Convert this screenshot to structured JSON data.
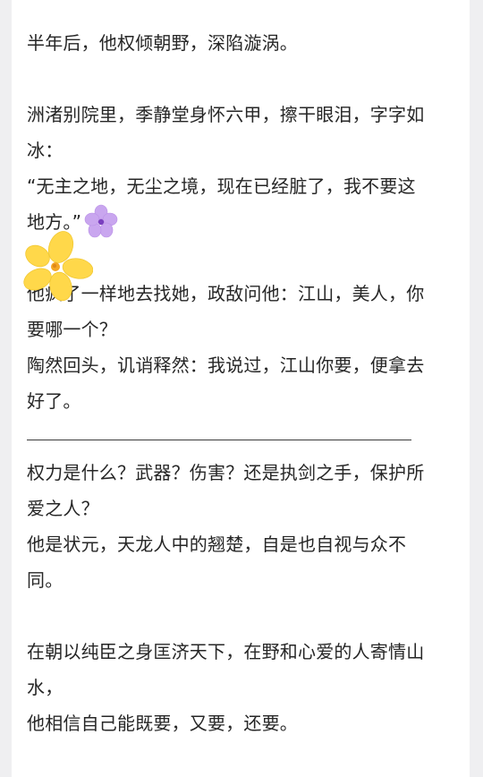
{
  "article": {
    "paragraphs": [
      "半年后，他权倾朝野，深陷漩涡。",
      "洲渚别院里，季静堂身怀六甲，擦干眼泪，字字如",
      "冰：",
      "“无主之地，无尘之境，现在已经脏了，我不要这",
      "地方。”",
      "他疯了一样地去找她，政敌问他：江山，美人，你",
      "要哪一个？",
      "陶然回头，讥诮释然：我说过，江山你要，便拿去",
      "好了。",
      "权力是什么？武器？伤害？还是执剑之手，保护所",
      "爱之人？",
      "他是状元，天龙人中的翘楚，自是也自视与众不",
      "同。",
      "在朝以纯臣之身匡济天下，在野和心爱的人寄情山",
      "水，",
      "他相信自己能既要，又要，还要。"
    ]
  },
  "stickers": {
    "purple_flower": "purple-flower-icon",
    "yellow_flower": "yellow-flower-icon"
  },
  "colors": {
    "page_background": "#efeff1",
    "card_background": "#ffffff",
    "text": "#262626",
    "purple_petal": "#c9a6ef",
    "yellow_petal": "#ffd84a"
  }
}
